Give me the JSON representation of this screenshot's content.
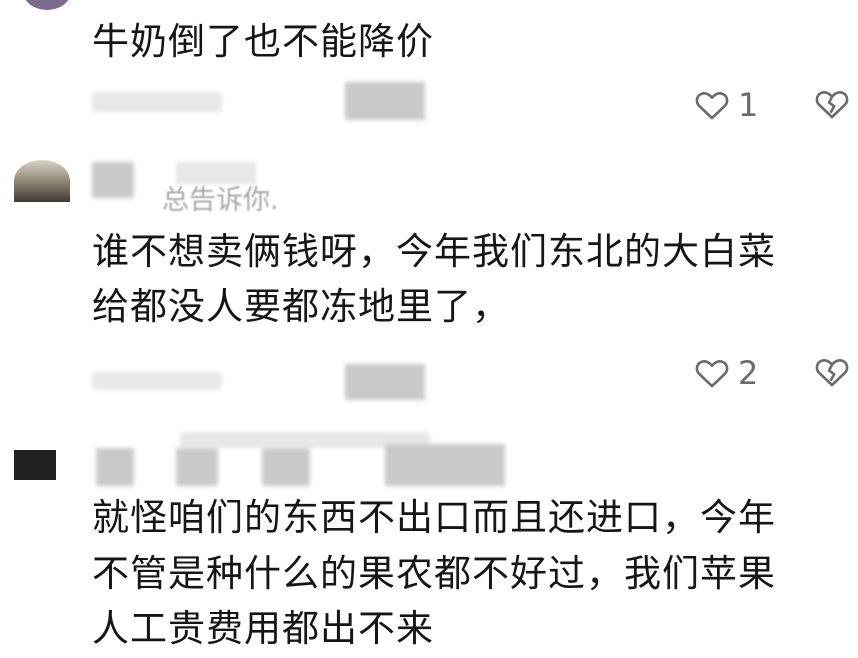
{
  "comments": [
    {
      "text": "牛奶倒了也不能降价",
      "likes": "1"
    },
    {
      "meta_fragment": "总告诉你.",
      "text_line1": "谁不想卖俩钱呀，今年我们东北的大白菜",
      "text_line2": "给都没人要都冻地里了，",
      "likes": "2"
    },
    {
      "text_line1": "就怪咱们的东西不出口而且还进口，今年",
      "text_line2": "不管是种什么的果农都不好过，我们苹果",
      "text_line3": "人工贵费用都出不来"
    }
  ],
  "icons": {
    "like": "heart-outline-icon",
    "dislike": "broken-heart-icon"
  }
}
